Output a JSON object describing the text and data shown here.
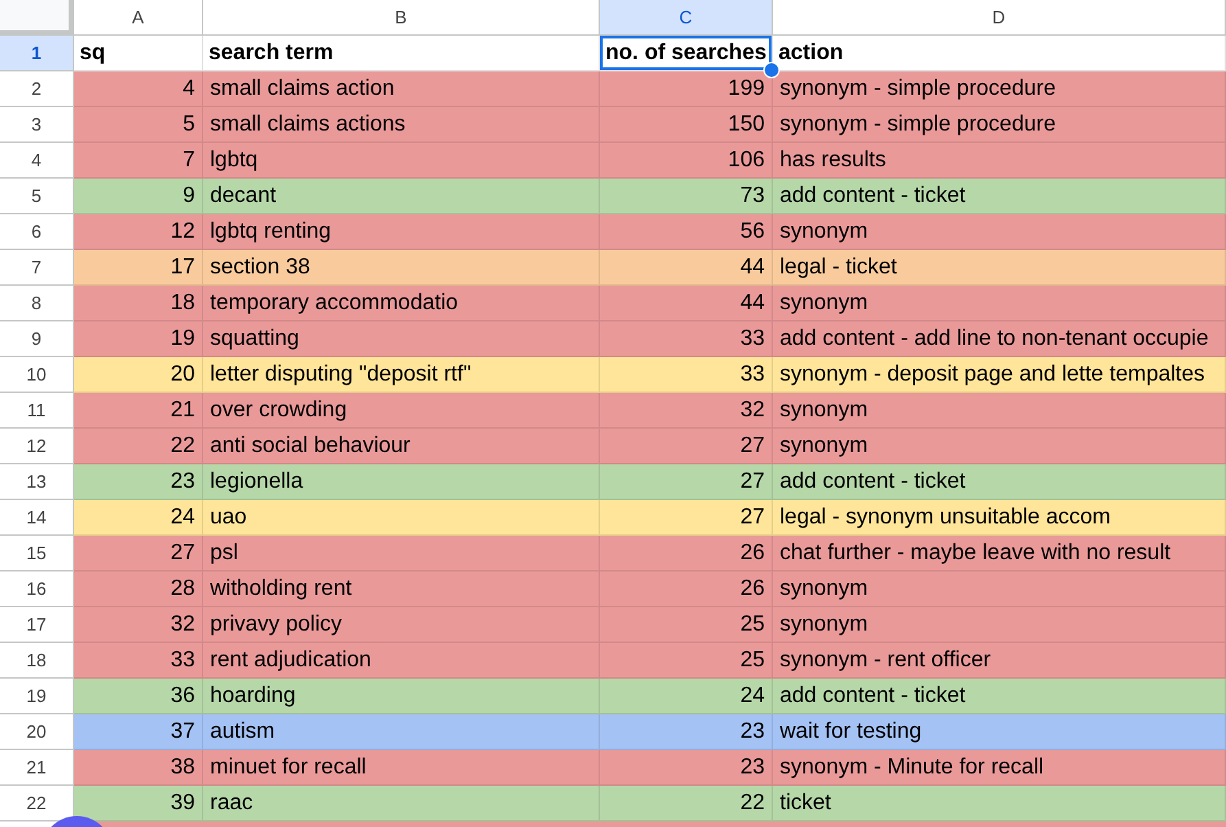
{
  "columns": [
    {
      "letter": "A",
      "kind": "number",
      "selected": false
    },
    {
      "letter": "B",
      "kind": "text",
      "selected": false
    },
    {
      "letter": "C",
      "kind": "number",
      "selected": true
    },
    {
      "letter": "D",
      "kind": "text",
      "selected": false
    }
  ],
  "header_row": {
    "number": "1",
    "selected": true,
    "cells": [
      {
        "text": "sq",
        "selected": false
      },
      {
        "text": "search term",
        "selected": false
      },
      {
        "text": "no. of searches",
        "selected": true
      },
      {
        "text": "action",
        "selected": false
      }
    ]
  },
  "rows": [
    {
      "number": "2",
      "color": "#ea9999",
      "cells": [
        "4",
        "small claims action",
        "199",
        "synonym - simple procedure"
      ]
    },
    {
      "number": "3",
      "color": "#ea9999",
      "cells": [
        "5",
        "small claims actions",
        "150",
        "synonym - simple procedure"
      ]
    },
    {
      "number": "4",
      "color": "#ea9999",
      "cells": [
        "7",
        "lgbtq",
        "106",
        "has results"
      ]
    },
    {
      "number": "5",
      "color": "#b6d7a8",
      "cells": [
        "9",
        "decant",
        "73",
        "add content - ticket"
      ]
    },
    {
      "number": "6",
      "color": "#ea9999",
      "cells": [
        "12",
        "lgbtq renting",
        "56",
        "synonym"
      ]
    },
    {
      "number": "7",
      "color": "#f9cb9c",
      "cells": [
        "17",
        "section 38",
        "44",
        "legal - ticket"
      ]
    },
    {
      "number": "8",
      "color": "#ea9999",
      "cells": [
        "18",
        "temporary accommodatio",
        "44",
        "synonym"
      ]
    },
    {
      "number": "9",
      "color": "#ea9999",
      "cells": [
        "19",
        "squatting",
        "33",
        "add content - add line to non-tenant occupie"
      ]
    },
    {
      "number": "10",
      "color": "#ffe599",
      "cells": [
        "20",
        "letter disputing \"deposit rtf\"",
        "33",
        "synonym - deposit page and lette tempaltes"
      ]
    },
    {
      "number": "11",
      "color": "#ea9999",
      "cells": [
        "21",
        "over crowding",
        "32",
        "synonym"
      ]
    },
    {
      "number": "12",
      "color": "#ea9999",
      "cells": [
        "22",
        "anti social behaviour",
        "27",
        "synonym"
      ]
    },
    {
      "number": "13",
      "color": "#b6d7a8",
      "cells": [
        "23",
        "legionella",
        "27",
        "add content - ticket"
      ]
    },
    {
      "number": "14",
      "color": "#ffe599",
      "cells": [
        "24",
        "uao",
        "27",
        "legal - synonym unsuitable accom"
      ]
    },
    {
      "number": "15",
      "color": "#ea9999",
      "cells": [
        "27",
        "psl",
        "26",
        "chat further - maybe leave with no result"
      ]
    },
    {
      "number": "16",
      "color": "#ea9999",
      "cells": [
        "28",
        "witholding rent",
        "26",
        "synonym"
      ]
    },
    {
      "number": "17",
      "color": "#ea9999",
      "cells": [
        "32",
        "privavy policy",
        "25",
        "synonym"
      ]
    },
    {
      "number": "18",
      "color": "#ea9999",
      "cells": [
        "33",
        "rent adjudication",
        "25",
        "synonym - rent officer"
      ]
    },
    {
      "number": "19",
      "color": "#b6d7a8",
      "cells": [
        "36",
        "hoarding",
        "24",
        "add content - ticket"
      ]
    },
    {
      "number": "20",
      "color": "#a4c2f4",
      "cells": [
        "37",
        "autism",
        "23",
        "wait for testing"
      ]
    },
    {
      "number": "21",
      "color": "#ea9999",
      "cells": [
        "38",
        "minuet for recall",
        "23",
        "synonym - Minute for recall"
      ]
    },
    {
      "number": "22",
      "color": "#b6d7a8",
      "cells": [
        "39",
        "raac",
        "22",
        "ticket"
      ]
    }
  ],
  "partial_row": {
    "color": "#ea9999"
  }
}
